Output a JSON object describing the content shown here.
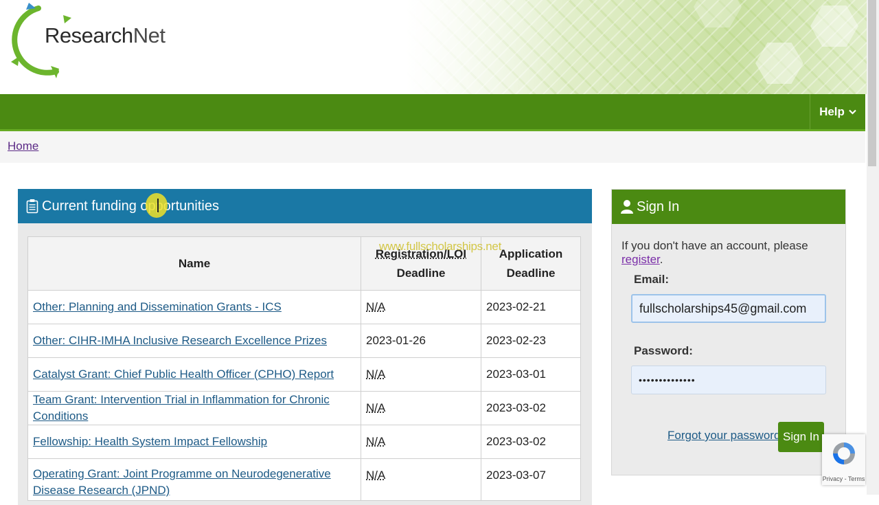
{
  "brand": {
    "logo_research": "Research",
    "logo_net": "Net"
  },
  "nav": {
    "help_label": "Help"
  },
  "breadcrumb": {
    "home": "Home"
  },
  "funding": {
    "title": "Current funding opportunities",
    "headers": {
      "name": "Name",
      "reg_line1": "Registration/LOI",
      "reg_line2": "Deadline",
      "app_line1": "Application",
      "app_line2": "Deadline"
    },
    "rows": [
      {
        "name": "Other: Planning and Dissemination Grants - ICS",
        "reg": "N/A",
        "app": "2023-02-21"
      },
      {
        "name": "Other: CIHR-IMHA Inclusive Research Excellence Prizes",
        "reg": "2023-01-26",
        "app": "2023-02-23"
      },
      {
        "name": "Catalyst Grant: Chief Public Health Officer (CPHO) Report",
        "reg": "N/A",
        "app": "2023-03-01"
      },
      {
        "name": "Team Grant: Intervention Trial in Inflammation for Chronic Conditions",
        "reg": "N/A",
        "app": "2023-03-02"
      },
      {
        "name": "Fellowship: Health System Impact Fellowship",
        "reg": "N/A",
        "app": "2023-03-02"
      },
      {
        "name": "Operating Grant: Joint Programme on Neurodegenerative Disease Research (JPND)",
        "reg": "N/A",
        "app": "2023-03-07"
      }
    ]
  },
  "watermark": "www.fullscholarships.net",
  "signin": {
    "title": "Sign In",
    "note_prefix": "If you don't have an account, please ",
    "register_link": "register",
    "note_suffix": ".",
    "email_label": "Email:",
    "email_value": "fullscholarships45@gmail.com",
    "password_label": "Password:",
    "password_value": "••••••••••••••",
    "forgot_link": "Forgot your password?",
    "button": "Sign In"
  },
  "recaptcha": {
    "terms": "Privacy - Terms"
  },
  "colors": {
    "nav_green": "#4b8a12",
    "panel_blue": "#1a78a5",
    "link_blue": "#1d5a86",
    "link_purple": "#7a2ea8"
  }
}
